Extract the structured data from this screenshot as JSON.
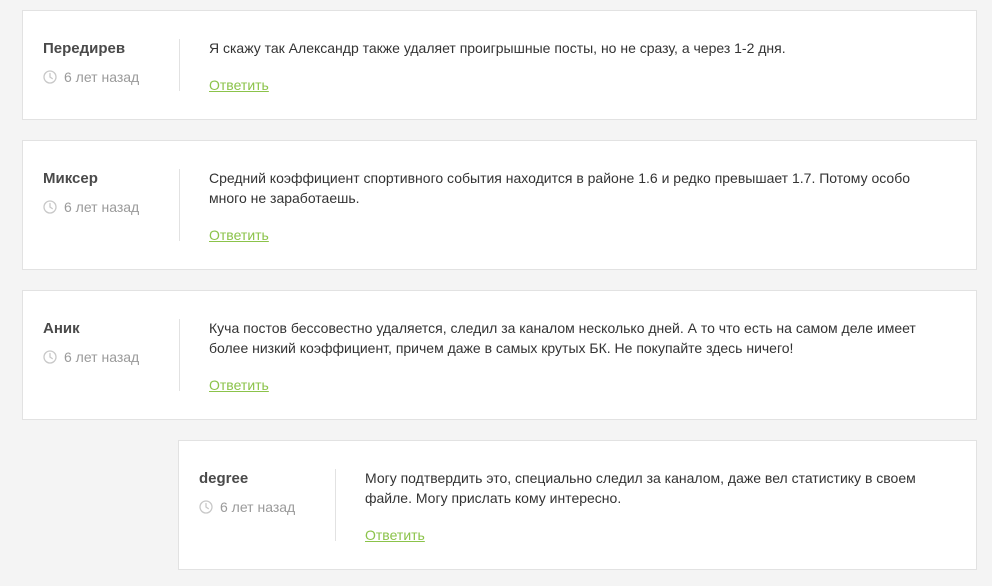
{
  "comments": [
    {
      "author": "Передирев",
      "time": "6 лет назад",
      "text": "Я скажу так Александр также удаляет проигрышные посты, но не сразу, а через 1-2 дня.",
      "reply_label": "Ответить"
    },
    {
      "author": "Миксер",
      "time": "6 лет назад",
      "text": "Средний коэффициент спортивного события находится в районе 1.6 и редко превышает 1.7. Потому особо много не заработаешь.",
      "reply_label": "Ответить"
    },
    {
      "author": "Аник",
      "time": "6 лет назад",
      "text": "Куча постов бессовестно удаляется, следил за каналом несколько дней. А то что есть на самом деле имеет более низкий коэффициент, причем даже в самых крутых БК. Не покупайте здесь ничего!",
      "reply_label": "Ответить"
    },
    {
      "author": "degree",
      "time": "6 лет назад",
      "text": "Могу подтвердить это, специально следил за каналом, даже вел статистику в своем файле. Могу прислать кому интересно.",
      "reply_label": "Ответить"
    }
  ],
  "icons": {
    "time": "clock-icon"
  },
  "colors": {
    "reply_link": "#8bc34a",
    "author": "#4a4a4a",
    "meta": "#9a9a9a",
    "border": "#e2e2e2",
    "page_bg": "#f4f4f4"
  }
}
